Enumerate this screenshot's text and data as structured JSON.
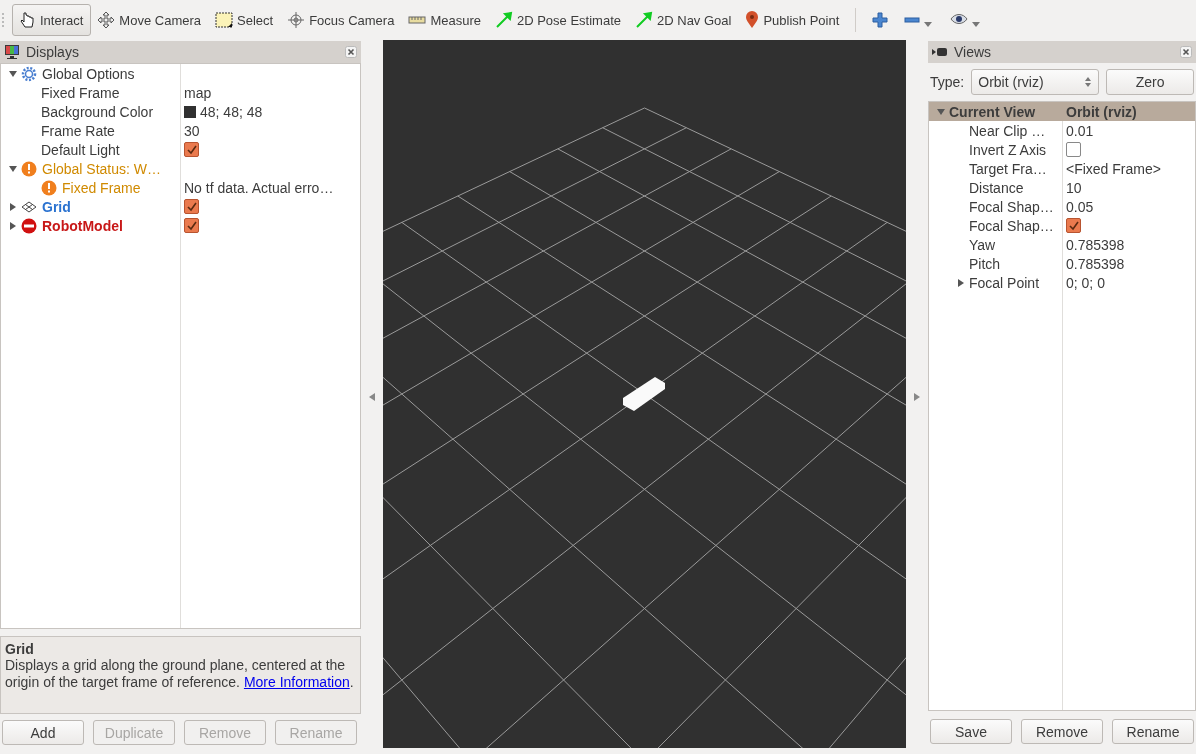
{
  "toolbar": {
    "tools": [
      {
        "kind": "interact",
        "label": "Interact",
        "selected": true
      },
      {
        "kind": "move",
        "label": "Move Camera",
        "selected": false
      },
      {
        "kind": "select",
        "label": "Select",
        "selected": false
      },
      {
        "kind": "focus",
        "label": "Focus Camera",
        "selected": false
      },
      {
        "kind": "measure",
        "label": "Measure",
        "selected": false
      },
      {
        "kind": "pose",
        "label": "2D Pose Estimate",
        "selected": false
      },
      {
        "kind": "nav",
        "label": "2D Nav Goal",
        "selected": false
      },
      {
        "kind": "point",
        "label": "Publish Point",
        "selected": false
      }
    ],
    "actions": [
      {
        "kind": "add"
      },
      {
        "kind": "remove"
      },
      {
        "kind": "view"
      }
    ]
  },
  "displays": {
    "title": "Displays",
    "items": [
      {
        "kind": "options",
        "label": "Global Options",
        "expanded": true,
        "children": [
          {
            "label": "Fixed Frame",
            "value": "map"
          },
          {
            "label": "Background Color",
            "value": "48; 48; 48",
            "color": "#303030"
          },
          {
            "label": "Frame Rate",
            "value": "30"
          },
          {
            "label": "Default Light",
            "checked": true
          }
        ]
      },
      {
        "kind": "warning",
        "label": "Global Status: W…",
        "expanded": true,
        "children": [
          {
            "kind": "warning",
            "label": "Fixed Frame",
            "value": "No tf data.  Actual erro…"
          }
        ]
      },
      {
        "kind": "grid",
        "label": "Grid",
        "expanded": false,
        "checked": true
      },
      {
        "kind": "error",
        "label": "RobotModel",
        "expanded": false,
        "checked": true
      }
    ],
    "description": {
      "title": "Grid",
      "text": "Displays a grid along the ground plane, centered at the origin of the target frame of reference. ",
      "link": "More Information",
      "after": "."
    },
    "buttons": [
      {
        "label": "Add",
        "disabled": false
      },
      {
        "label": "Duplicate",
        "disabled": true
      },
      {
        "label": "Remove",
        "disabled": true
      },
      {
        "label": "Rename",
        "disabled": true
      }
    ]
  },
  "views": {
    "title": "Views",
    "type_label": "Type:",
    "type_value": "Orbit (rviz)",
    "zero": "Zero",
    "items": [
      {
        "kind": "header",
        "label": "Current View",
        "value": "Orbit (rviz)",
        "expanded": true,
        "children": [
          {
            "label": "Near Clip …",
            "value": "0.01"
          },
          {
            "label": "Invert Z Axis",
            "checked": false
          },
          {
            "label": "Target Fra…",
            "value": "<Fixed Frame>"
          },
          {
            "label": "Distance",
            "value": "10"
          },
          {
            "label": "Focal Shap…",
            "value": "0.05"
          },
          {
            "label": "Focal Shap…",
            "checked": true
          },
          {
            "label": "Yaw",
            "value": "0.785398"
          },
          {
            "label": "Pitch",
            "value": "0.785398"
          },
          {
            "label": "Focal Point",
            "value": "0; 0; 0",
            "expanded": false
          }
        ]
      }
    ],
    "buttons": [
      {
        "label": "Save",
        "disabled": false
      },
      {
        "label": "Remove",
        "disabled": false
      },
      {
        "label": "Rename",
        "disabled": false
      }
    ]
  }
}
